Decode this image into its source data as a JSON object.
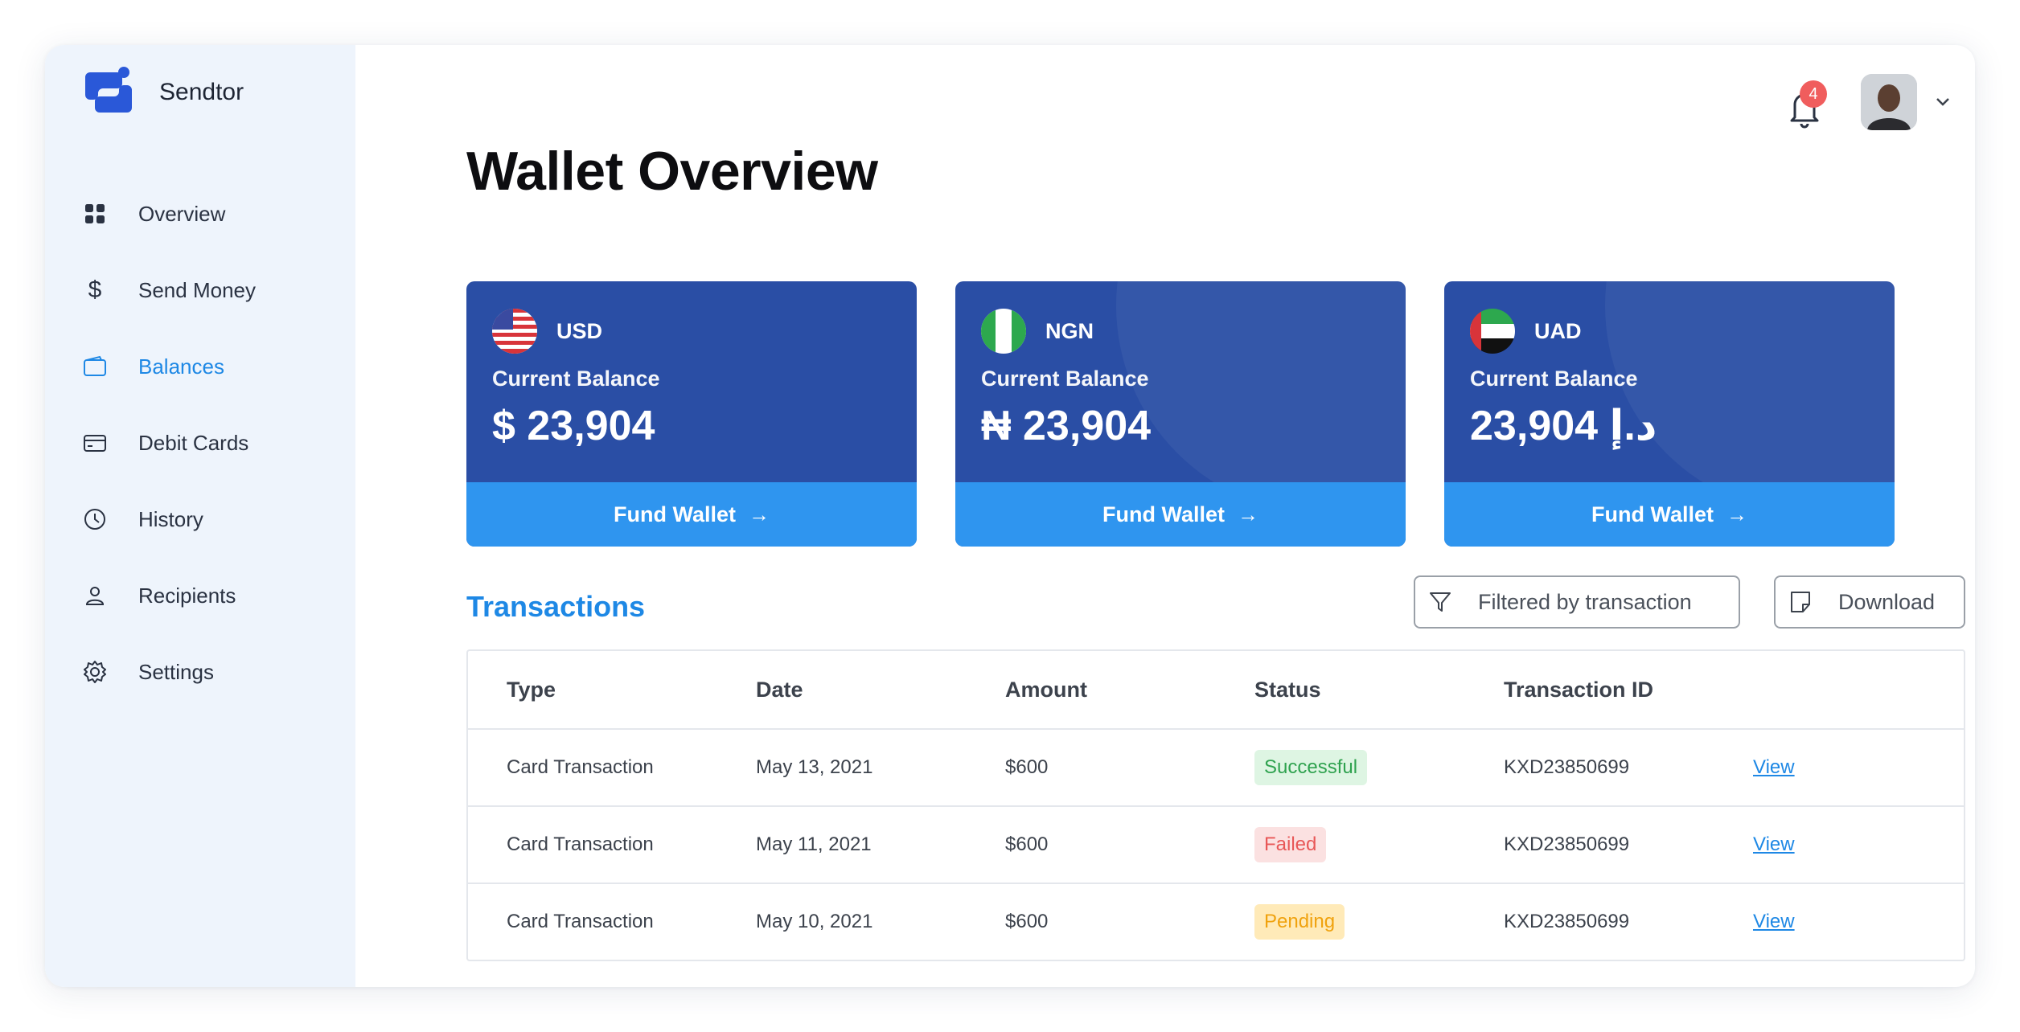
{
  "app": {
    "name": "Sendtor",
    "accent": "#1e88e5"
  },
  "sidebar": {
    "items": [
      {
        "label": "Overview",
        "icon": "grid-icon",
        "active": false
      },
      {
        "label": "Send Money",
        "icon": "dollar-icon",
        "active": false
      },
      {
        "label": "Balances",
        "icon": "wallet-icon",
        "active": true
      },
      {
        "label": "Debit Cards",
        "icon": "card-icon",
        "active": false
      },
      {
        "label": "History",
        "icon": "clock-icon",
        "active": false
      },
      {
        "label": "Recipients",
        "icon": "user-icon",
        "active": false
      },
      {
        "label": "Settings",
        "icon": "gear-icon",
        "active": false
      }
    ]
  },
  "header": {
    "notifications": "4"
  },
  "page": {
    "title": "Wallet Overview"
  },
  "wallets": [
    {
      "code": "USD",
      "label": "Current Balance",
      "balance": "$ 23,904",
      "action": "Fund Wallet"
    },
    {
      "code": "NGN",
      "label": "Current Balance",
      "balance": "₦ 23,904",
      "action": "Fund Wallet"
    },
    {
      "code": "UAD",
      "label": "Current Balance",
      "balance": "23,904 د.إ",
      "action": "Fund Wallet"
    }
  ],
  "transactions": {
    "title": "Transactions",
    "filter_label": "Filtered by transaction",
    "download_label": "Download",
    "columns": [
      "Type",
      "Date",
      "Amount",
      "Status",
      "Transaction ID"
    ],
    "rows": [
      {
        "type": "Card Transaction",
        "date": "May 13, 2021",
        "amount": "$600",
        "status": "Successful",
        "id": "KXD23850699",
        "action": "View"
      },
      {
        "type": "Card Transaction",
        "date": "May 11, 2021",
        "amount": "$600",
        "status": "Failed",
        "id": "KXD23850699",
        "action": "View"
      },
      {
        "type": "Card Transaction",
        "date": "May 10, 2021",
        "amount": "$600",
        "status": "Pending",
        "id": "KXD23850699",
        "action": "View"
      }
    ]
  }
}
